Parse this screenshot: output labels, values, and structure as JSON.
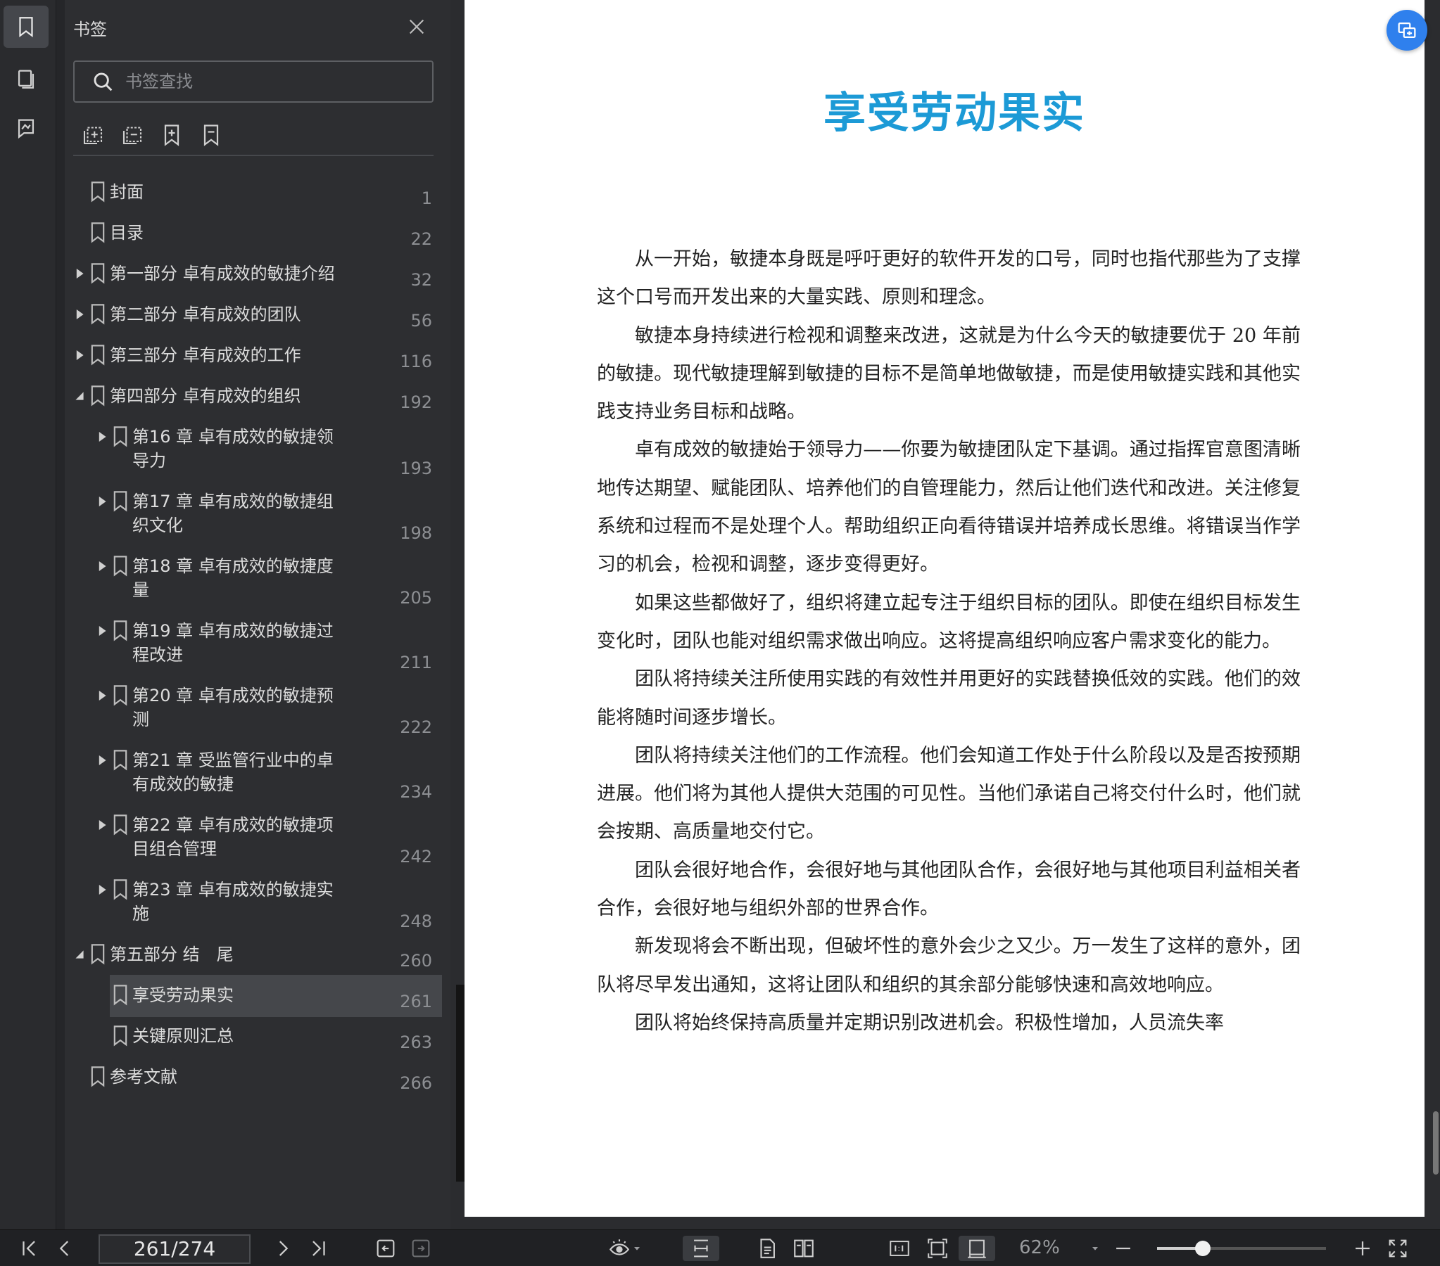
{
  "sidebar": {
    "title": "书签",
    "search_placeholder": "书签查找",
    "rail_icons": [
      "bookmark-icon",
      "thumbnail-icon",
      "annotation-icon"
    ],
    "tool_icons": [
      "expand-all-icon",
      "collapse-all-icon",
      "add-bookmark-icon",
      "bookmark-outline-icon"
    ],
    "items": [
      {
        "label": "封面",
        "page": "1"
      },
      {
        "label": "目录",
        "page": "22"
      },
      {
        "label": "第一部分 卓有成效的敏捷介绍",
        "page": "32"
      },
      {
        "label": "第二部分 卓有成效的团队",
        "page": "56"
      },
      {
        "label": "第三部分 卓有成效的工作",
        "page": "116"
      },
      {
        "label": "第四部分 卓有成效的组织",
        "page": "192"
      },
      {
        "label": "第16 章 卓有成效的敏捷领",
        "label2": "导力",
        "page": "193"
      },
      {
        "label": "第17 章 卓有成效的敏捷组",
        "label2": "织文化",
        "page": "198"
      },
      {
        "label": "第18 章 卓有成效的敏捷度",
        "label2": "量",
        "page": "205"
      },
      {
        "label": "第19 章 卓有成效的敏捷过",
        "label2": "程改进",
        "page": "211"
      },
      {
        "label": "第20 章 卓有成效的敏捷预",
        "label2": "测",
        "page": "222"
      },
      {
        "label": "第21 章 受监管行业中的卓",
        "label2": "有成效的敏捷",
        "page": "234"
      },
      {
        "label": "第22 章 卓有成效的敏捷项",
        "label2": "目组合管理",
        "page": "242"
      },
      {
        "label": "第23 章 卓有成效的敏捷实",
        "label2": "施",
        "page": "248"
      },
      {
        "label": "第五部分 结　尾",
        "page": "260"
      },
      {
        "label": "享受劳动果实",
        "page": "261"
      },
      {
        "label": "关键原则汇总",
        "page": "263"
      },
      {
        "label": "参考文献",
        "page": "266"
      }
    ]
  },
  "document": {
    "title": "享受劳动果实",
    "paragraphs": [
      "从一开始，敏捷本身既是呼吁更好的软件开发的口号，同时也指代那些为了支撑这个口号而开发出来的大量实践、原则和理念。",
      "敏捷本身持续进行检视和调整来改进，这就是为什么今天的敏捷要优于 20 年前的敏捷。现代敏捷理解到敏捷的目标不是简单地做敏捷，而是使用敏捷实践和其他实践支持业务目标和战略。",
      "卓有成效的敏捷始于领导力——你要为敏捷团队定下基调。通过指挥官意图清晰地传达期望、赋能团队、培养他们的自管理能力，然后让他们迭代和改进。关注修复系统和过程而不是处理个人。帮助组织正向看待错误并培养成长思维。将错误当作学习的机会，检视和调整，逐步变得更好。",
      "如果这些都做好了，组织将建立起专注于组织目标的团队。即使在组织目标发生变化时，团队也能对组织需求做出响应。这将提高组织响应客户需求变化的能力。",
      "团队将持续关注所使用实践的有效性并用更好的实践替换低效的实践。他们的效能将随时间逐步增长。",
      "团队将持续关注他们的工作流程。他们会知道工作处于什么阶段以及是否按预期进展。他们将为其他人提供大范围的可见性。当他们承诺自己将交付什么时，他们就会按期、高质量地交付它。",
      "团队会很好地合作，会很好地与其他团队合作，会很好地与其他项目利益相关者合作，会很好地与组织外部的世界合作。",
      "新发现将会不断出现，但破坏性的意外会少之又少。万一发生了这样的意外，团队将尽早发出通知，这将让团队和组织的其余部分能够快速和高效地响应。",
      "团队将始终保持高质量并定期识别改进机会。积极性增加，人员流失率"
    ]
  },
  "toolbar": {
    "page_indicator": "261/274",
    "zoom": "62%",
    "zoom_fraction": 0.27
  },
  "colors": {
    "accent": "#1c9ad6",
    "fab": "#2f80ed"
  }
}
